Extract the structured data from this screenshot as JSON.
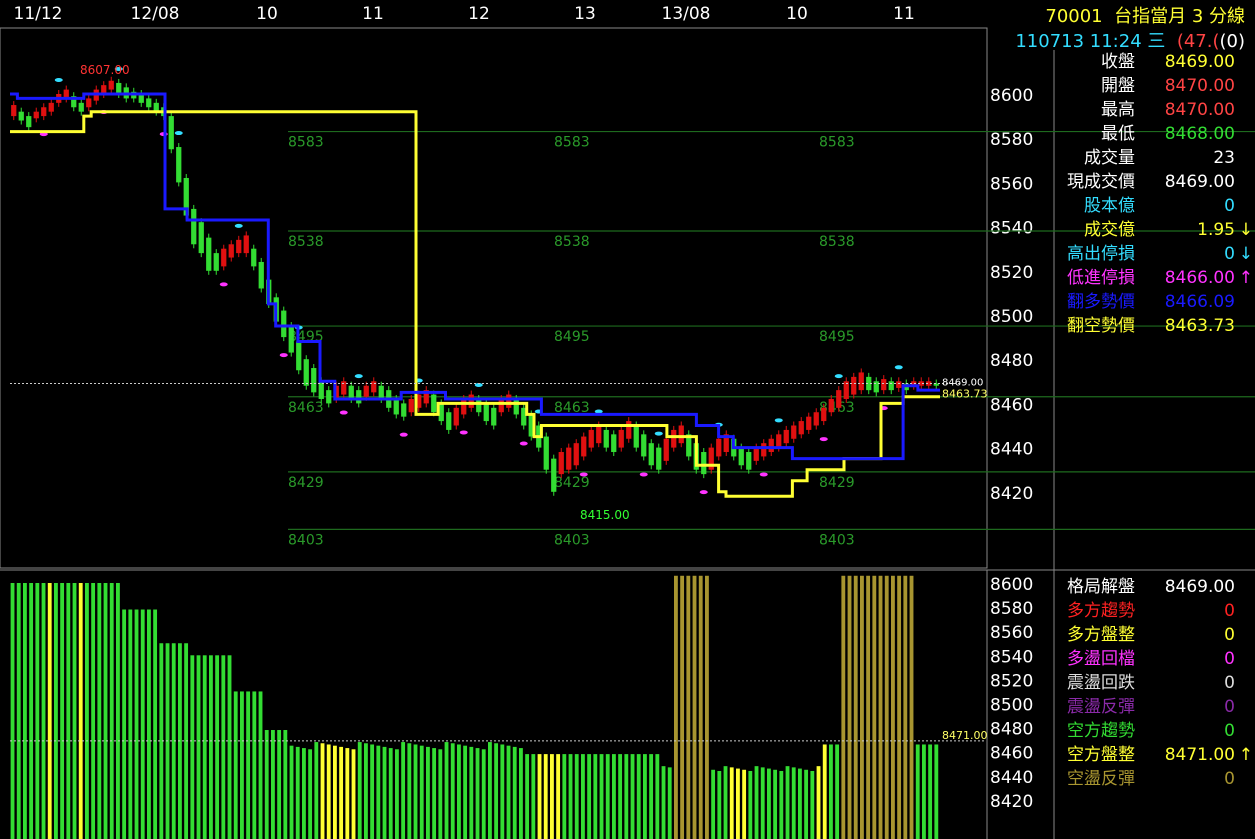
{
  "header": {
    "symbol": "70001",
    "name": "台指當月 3 分線",
    "datetime": "110713 11:24 三",
    "change": "(47.(",
    "change_tail": "(0)"
  },
  "colors": {
    "background": "#000000",
    "up": "#e01010",
    "down": "#33dd33",
    "blue_line": "#1a1aff",
    "yellow_line": "#ffff33",
    "magenta": "#ff33ff",
    "cyan": "#33ddff",
    "olive": "#a89530",
    "grid_green": "#1e6a1e"
  },
  "info_panel": [
    {
      "label": "收盤",
      "value": "8469.00",
      "label_color": "#ffffff",
      "value_color": "#ffff33"
    },
    {
      "label": "開盤",
      "value": "8470.00",
      "label_color": "#ffffff",
      "value_color": "#ff4444"
    },
    {
      "label": "最高",
      "value": "8470.00",
      "label_color": "#ffffff",
      "value_color": "#ff4444"
    },
    {
      "label": "最低",
      "value": "8468.00",
      "label_color": "#ffffff",
      "value_color": "#33dd33"
    },
    {
      "label": "成交量",
      "value": "23",
      "label_color": "#ffffff",
      "value_color": "#ffffff"
    },
    {
      "label": "現成交價",
      "value": "8469.00",
      "label_color": "#ffffff",
      "value_color": "#ffffff"
    },
    {
      "label": "股本億",
      "value": "0",
      "label_color": "#33ddff",
      "value_color": "#33ddff"
    },
    {
      "label": "成交億",
      "value": "1.95",
      "label_color": "#ffff33",
      "value_color": "#ffff33",
      "arrow": "↓",
      "arrow_color": "#ffff33"
    },
    {
      "label": "高出停損",
      "value": "0",
      "label_color": "#33ddff",
      "value_color": "#33ddff",
      "arrow": "↓",
      "arrow_color": "#33ddff"
    },
    {
      "label": "低進停損",
      "value": "8466.00",
      "label_color": "#ff33ff",
      "value_color": "#ff33ff",
      "arrow": "↑",
      "arrow_color": "#ff33ff"
    },
    {
      "label": "翻多勢價",
      "value": "8466.09",
      "label_color": "#1a1aff",
      "value_color": "#1a1aff"
    },
    {
      "label": "翻空勢價",
      "value": "8463.73",
      "label_color": "#ffff33",
      "value_color": "#ffff33"
    }
  ],
  "status_panel": [
    {
      "label": "格局解盤",
      "value": "8469.00",
      "label_color": "#ffffff",
      "value_color": "#ffffff"
    },
    {
      "label": "多方趨勢",
      "value": "0",
      "label_color": "#ff2222",
      "value_color": "#ff2222"
    },
    {
      "label": "多方盤整",
      "value": "0",
      "label_color": "#ffff33",
      "value_color": "#ffff33"
    },
    {
      "label": "多盪回檔",
      "value": "0",
      "label_color": "#ff33ff",
      "value_color": "#ff33ff"
    },
    {
      "label": "震盪回跌",
      "value": "0",
      "label_color": "#dddddd",
      "value_color": "#dddddd"
    },
    {
      "label": "震盪反彈",
      "value": "0",
      "label_color": "#8a2aa8",
      "value_color": "#8a2aa8"
    },
    {
      "label": "空方趨勢",
      "value": "0",
      "label_color": "#33dd33",
      "value_color": "#33dd33"
    },
    {
      "label": "空方盤整",
      "value": "8471.00",
      "label_color": "#ffff33",
      "value_color": "#ffff33",
      "arrow": "↑",
      "arrow_color": "#ffff33"
    },
    {
      "label": "空盪反彈",
      "value": "0",
      "label_color": "#a89530",
      "value_color": "#a89530"
    }
  ],
  "chart_data": [
    {
      "type": "candlestick",
      "x_tick_labels": [
        "11/12",
        "12/08",
        "10",
        "11",
        "12",
        "13",
        "13/08",
        "10",
        "11"
      ],
      "y_ticks": [
        8600,
        8580,
        8560,
        8540,
        8520,
        8500,
        8480,
        8460,
        8440,
        8420
      ],
      "ylim": [
        8397,
        8615
      ],
      "hlines": [
        {
          "value": 8583,
          "labels": [
            "8583",
            "8583",
            "8583"
          ]
        },
        {
          "value": 8538,
          "labels": [
            "8538",
            "8538",
            "8538"
          ]
        },
        {
          "value": 8495,
          "labels": [
            "8495",
            "8495",
            "8495"
          ]
        },
        {
          "value": 8463,
          "labels": [
            "8463",
            "8463",
            "8463"
          ]
        },
        {
          "value": 8429,
          "labels": [
            "8429",
            "8429",
            "8429"
          ]
        },
        {
          "value": 8403,
          "labels": [
            "8403",
            "8403",
            "8403"
          ]
        }
      ],
      "last_price": 8469.0,
      "last_price_label": "8469.00",
      "last_label_2": "8463.73",
      "high_annotation": "8607.00",
      "low_annotation": "8415.00",
      "blue_line": [
        8600,
        8598,
        8598,
        8598,
        8598,
        8598,
        8598,
        8598,
        8598,
        8598,
        8600,
        8600,
        8600,
        8600,
        8600,
        8600,
        8600,
        8600,
        8600,
        8600,
        8600,
        8548,
        8548,
        8548,
        8543,
        8543,
        8543,
        8543,
        8543,
        8543,
        8543,
        8543,
        8543,
        8543,
        8543,
        8505,
        8495,
        8495,
        8495,
        8488,
        8488,
        8488,
        8470,
        8470,
        8462,
        8462,
        8462,
        8462,
        8462,
        8462,
        8462,
        8462,
        8462,
        8465,
        8465,
        8465,
        8465,
        8465,
        8465,
        8462,
        8462,
        8462,
        8462,
        8462,
        8462,
        8462,
        8462,
        8462,
        8462,
        8462,
        8462,
        8462,
        8455,
        8455,
        8455,
        8455,
        8455,
        8455,
        8455,
        8455,
        8455,
        8455,
        8455,
        8455,
        8455,
        8455,
        8455,
        8455,
        8455,
        8455,
        8455,
        8455,
        8455,
        8450,
        8450,
        8450,
        8445,
        8445,
        8440,
        8440,
        8440,
        8440,
        8440,
        8440,
        8440,
        8440,
        8435,
        8435,
        8435,
        8435,
        8435,
        8435,
        8435,
        8435,
        8435,
        8435,
        8435,
        8435,
        8435,
        8435,
        8435,
        8468,
        8468,
        8466,
        8466,
        8466
      ],
      "yellow_line": [
        8583,
        8583,
        8583,
        8583,
        8583,
        8583,
        8583,
        8583,
        8583,
        8583,
        8590,
        8592,
        8592,
        8592,
        8592,
        8592,
        8592,
        8592,
        8592,
        8592,
        8592,
        8592,
        8592,
        8592,
        8592,
        8592,
        8592,
        8592,
        8592,
        8592,
        8592,
        8592,
        8592,
        8592,
        8592,
        8592,
        8592,
        8592,
        8592,
        8592,
        8592,
        8592,
        8592,
        8592,
        8592,
        8592,
        8592,
        8592,
        8592,
        8592,
        8592,
        8592,
        8592,
        8592,
        8592,
        8455,
        8455,
        8455,
        8460,
        8460,
        8460,
        8460,
        8460,
        8460,
        8460,
        8460,
        8460,
        8460,
        8460,
        8460,
        8455,
        8445,
        8450,
        8450,
        8450,
        8450,
        8450,
        8450,
        8450,
        8450,
        8450,
        8450,
        8450,
        8450,
        8450,
        8450,
        8450,
        8450,
        8450,
        8445,
        8445,
        8445,
        8445,
        8432,
        8432,
        8432,
        8420,
        8418,
        8418,
        8418,
        8418,
        8418,
        8418,
        8418,
        8418,
        8418,
        8425,
        8425,
        8430,
        8430,
        8430,
        8430,
        8430,
        8435,
        8435,
        8435,
        8435,
        8435,
        8460,
        8460,
        8460,
        8463,
        8463,
        8463,
        8463,
        8463
      ],
      "candles": [
        [
          8595,
          8590
        ],
        [
          8592,
          8588
        ],
        [
          8590,
          8585
        ],
        [
          8592,
          8589
        ],
        [
          8594,
          8590
        ],
        [
          8596,
          8592
        ],
        [
          8600,
          8596
        ],
        [
          8602,
          8598
        ],
        [
          8599,
          8594
        ],
        [
          8596,
          8592
        ],
        [
          8598,
          8594
        ],
        [
          8602,
          8597
        ],
        [
          8604,
          8600
        ],
        [
          8606,
          8602
        ],
        [
          8605,
          8600
        ],
        [
          8603,
          8598
        ],
        [
          8601,
          8598
        ],
        [
          8600,
          8596
        ],
        [
          8598,
          8594
        ],
        [
          8596,
          8592
        ],
        [
          8594,
          8590
        ],
        [
          8590,
          8575
        ],
        [
          8576,
          8560
        ],
        [
          8562,
          8545
        ],
        [
          8548,
          8532
        ],
        [
          8542,
          8528
        ],
        [
          8535,
          8520
        ],
        [
          8528,
          8520
        ],
        [
          8530,
          8522
        ],
        [
          8532,
          8526
        ],
        [
          8534,
          8528
        ],
        [
          8536,
          8528
        ],
        [
          8530,
          8522
        ],
        [
          8524,
          8512
        ],
        [
          8516,
          8505
        ],
        [
          8508,
          8497
        ],
        [
          8502,
          8490
        ],
        [
          8495,
          8483
        ],
        [
          8488,
          8475
        ],
        [
          8480,
          8468
        ],
        [
          8476,
          8465
        ],
        [
          8470,
          8462
        ],
        [
          8466,
          8460
        ],
        [
          8468,
          8462
        ],
        [
          8470,
          8464
        ],
        [
          8468,
          8462
        ],
        [
          8466,
          8460
        ],
        [
          8468,
          8463
        ],
        [
          8470,
          8465
        ],
        [
          8468,
          8462
        ],
        [
          8466,
          8458
        ],
        [
          8462,
          8455
        ],
        [
          8460,
          8454
        ],
        [
          8462,
          8456
        ],
        [
          8464,
          8458
        ],
        [
          8466,
          8460
        ],
        [
          8464,
          8456
        ],
        [
          8460,
          8452
        ],
        [
          8456,
          8448
        ],
        [
          8458,
          8450
        ],
        [
          8462,
          8455
        ],
        [
          8464,
          8458
        ],
        [
          8462,
          8456
        ],
        [
          8460,
          8452
        ],
        [
          8458,
          8450
        ],
        [
          8462,
          8456
        ],
        [
          8464,
          8458
        ],
        [
          8462,
          8455
        ],
        [
          8458,
          8450
        ],
        [
          8455,
          8445
        ],
        [
          8450,
          8440
        ],
        [
          8445,
          8430
        ],
        [
          8435,
          8420
        ],
        [
          8438,
          8428
        ],
        [
          8440,
          8430
        ],
        [
          8442,
          8432
        ],
        [
          8445,
          8436
        ],
        [
          8448,
          8440
        ],
        [
          8450,
          8442
        ],
        [
          8448,
          8440
        ],
        [
          8446,
          8438
        ],
        [
          8448,
          8440
        ],
        [
          8452,
          8444
        ],
        [
          8450,
          8440
        ],
        [
          8446,
          8436
        ],
        [
          8442,
          8432
        ],
        [
          8440,
          8430
        ],
        [
          8444,
          8434
        ],
        [
          8448,
          8440
        ],
        [
          8450,
          8442
        ],
        [
          8446,
          8436
        ],
        [
          8442,
          8430
        ],
        [
          8438,
          8428
        ],
        [
          8440,
          8430
        ],
        [
          8444,
          8436
        ],
        [
          8446,
          8438
        ],
        [
          8444,
          8436
        ],
        [
          8440,
          8432
        ],
        [
          8438,
          8430
        ],
        [
          8440,
          8434
        ],
        [
          8442,
          8436
        ],
        [
          8444,
          8438
        ],
        [
          8446,
          8440
        ],
        [
          8448,
          8442
        ],
        [
          8450,
          8444
        ],
        [
          8452,
          8446
        ],
        [
          8454,
          8448
        ],
        [
          8456,
          8450
        ],
        [
          8458,
          8452
        ],
        [
          8462,
          8456
        ],
        [
          8466,
          8458
        ],
        [
          8470,
          8462
        ],
        [
          8472,
          8464
        ],
        [
          8474,
          8466
        ],
        [
          8472,
          8466
        ],
        [
          8470,
          8465
        ],
        [
          8471,
          8466
        ],
        [
          8470,
          8466
        ],
        [
          8470,
          8467
        ],
        [
          8469,
          8466
        ],
        [
          8470,
          8468
        ],
        [
          8470,
          8468
        ],
        [
          8470,
          8468
        ],
        [
          8469,
          8468
        ]
      ]
    },
    {
      "type": "bar",
      "y_ticks": [
        8600,
        8580,
        8560,
        8540,
        8520,
        8500,
        8480,
        8460,
        8440,
        8420
      ],
      "ylim": [
        8416,
        8606
      ],
      "last_price": 8469.0,
      "last_label": "8471.00"
    }
  ]
}
